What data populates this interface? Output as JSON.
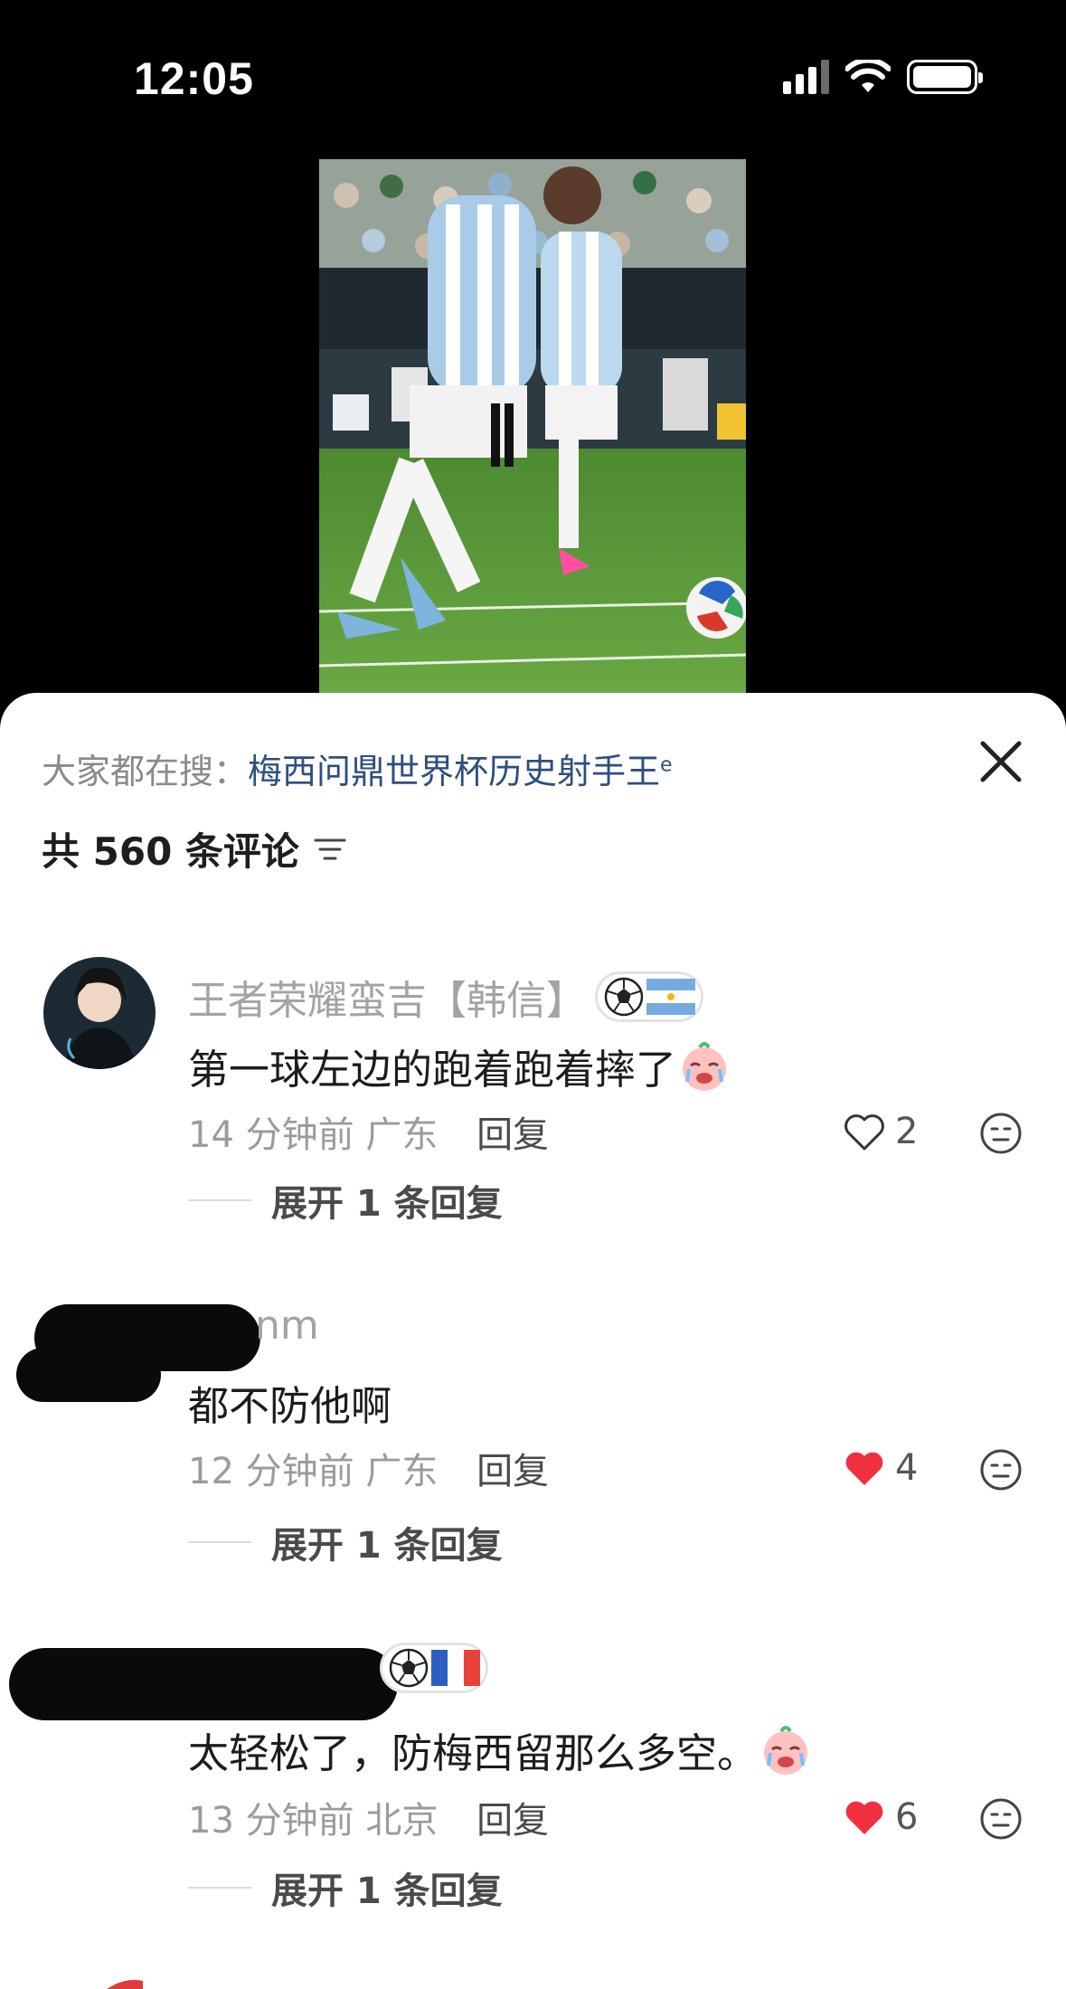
{
  "status_bar": {
    "time": "12:05"
  },
  "search": {
    "prefix": "大家都在搜：",
    "term": "梅西问鼎世界杯历史射手王",
    "icon": "search-icon"
  },
  "comments_header": {
    "count_label": "共 560 条评论",
    "sort_icon": "sort-icon"
  },
  "comments": [
    {
      "username": "王者荣耀蛮吉【韩信】",
      "badge": "soccer-ball-argentina-flag",
      "text": "第一球左边的跑着跑着摔了",
      "emoji": "crying-face-emoji",
      "time": "14 分钟前",
      "location": "广东",
      "reply_label": "回复",
      "likes": "2",
      "liked": false,
      "expand_label": "展开 1 条回复"
    },
    {
      "username": "nm",
      "text": "都不防他啊",
      "time": "12 分钟前",
      "location": "广东",
      "reply_label": "回复",
      "likes": "4",
      "liked": true,
      "expand_label": "展开 1 条回复"
    },
    {
      "badge": "soccer-ball-france-flag",
      "text": "太轻松了，防梅西留那么多空。",
      "emoji": "crying-face-emoji",
      "time": "13 分钟前",
      "location": "北京",
      "reply_label": "回复",
      "likes": "6",
      "liked": true,
      "expand_label": "展开 1 条回复"
    }
  ],
  "colors": {
    "like_red": "#f0303f",
    "search_term": "#2d4f7e",
    "meta_gray": "#9b9b9b"
  }
}
